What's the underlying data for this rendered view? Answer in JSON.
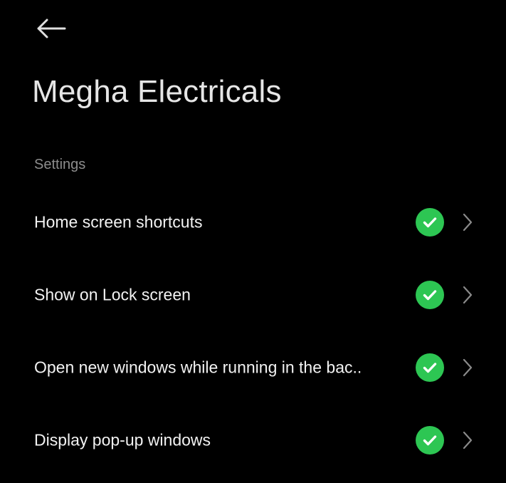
{
  "header": {
    "back_icon": "arrow-left-icon",
    "title": "Megha Electricals"
  },
  "section": {
    "header": "Settings"
  },
  "settings": [
    {
      "label": "Home screen shortcuts",
      "enabled": true,
      "status_icon": "check-circle-icon",
      "nav_icon": "chevron-right-icon"
    },
    {
      "label": "Show on Lock screen",
      "enabled": true,
      "status_icon": "check-circle-icon",
      "nav_icon": "chevron-right-icon"
    },
    {
      "label": "Open new windows while running in the bac..",
      "enabled": true,
      "status_icon": "check-circle-icon",
      "nav_icon": "chevron-right-icon"
    },
    {
      "label": "Display pop-up windows",
      "enabled": true,
      "status_icon": "check-circle-icon",
      "nav_icon": "chevron-right-icon"
    }
  ],
  "colors": {
    "background": "#000000",
    "text_primary": "#f2f2f2",
    "text_secondary": "#8d8d8d",
    "accent_green": "#2dc653",
    "chevron": "#8a8a8a"
  }
}
